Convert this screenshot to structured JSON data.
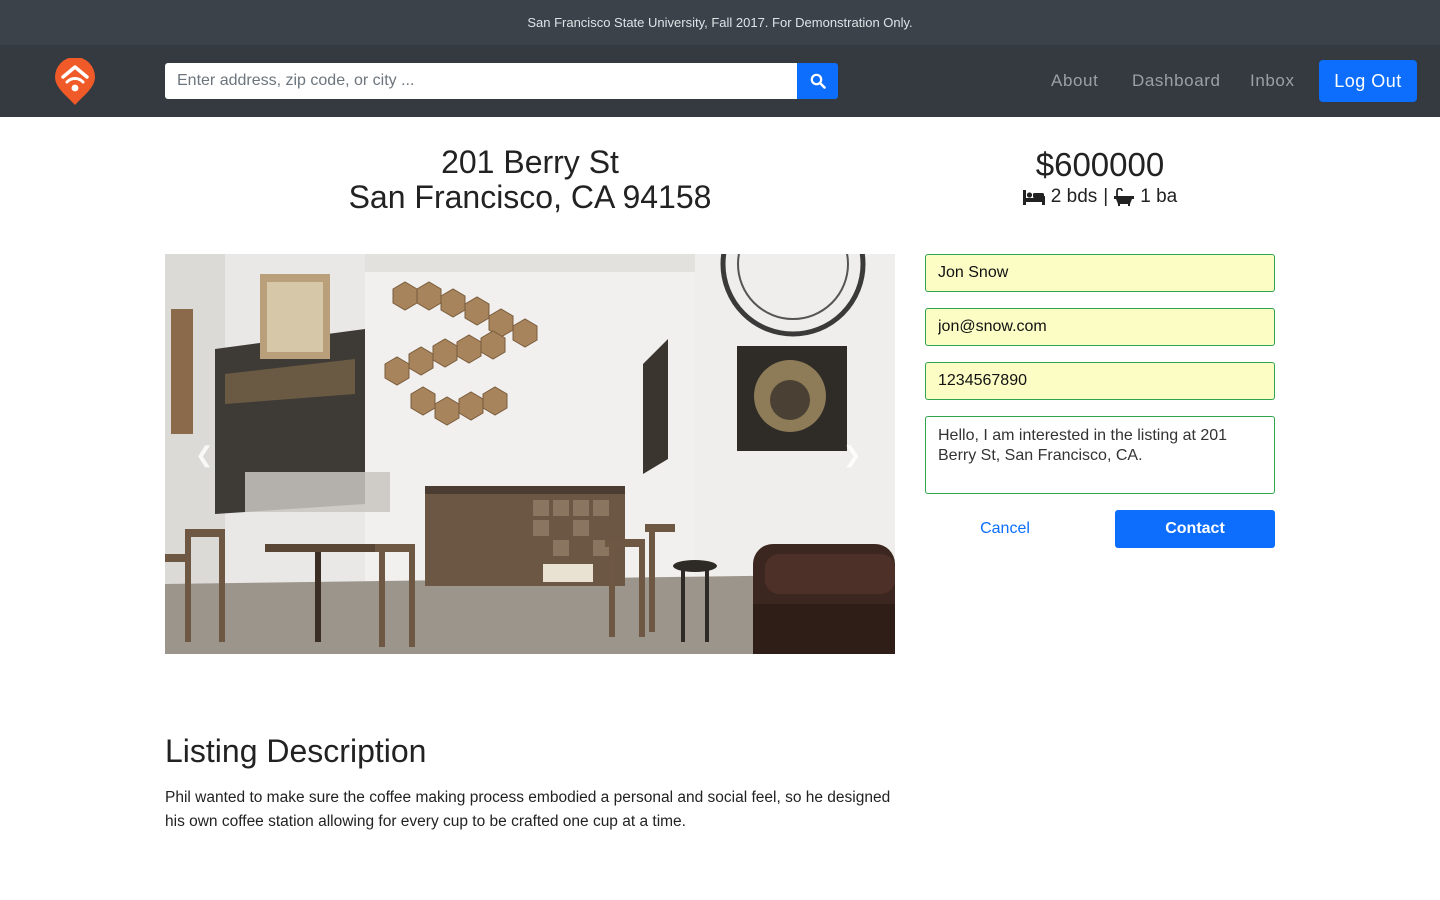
{
  "banner": {
    "text": "San Francisco State University, Fall 2017. For Demonstration Only."
  },
  "header": {
    "logo_icon": "house-pin-logo",
    "search": {
      "placeholder": "Enter address, zip code, or city ...",
      "value": "",
      "button_icon": "search-icon"
    },
    "nav": [
      {
        "label": "About"
      },
      {
        "label": "Dashboard"
      },
      {
        "label": "Inbox"
      }
    ],
    "logout_label": "Log Out",
    "colors": {
      "bar": "#343a40",
      "accent": "#0d6efd",
      "logo": "#f05a28"
    }
  },
  "listing": {
    "address_line1": "201 Berry St",
    "address_line2": "San Francisco, CA 94158",
    "price": "$600000",
    "beds": "2 bds",
    "baths": "1 ba",
    "separator": "|",
    "bed_icon": "bed-icon",
    "bath_icon": "bathtub-icon",
    "photo_icons": {
      "prev": "chevron-left-icon",
      "next": "chevron-right-icon"
    }
  },
  "contact_form": {
    "name": "Jon Snow",
    "email": "jon@snow.com",
    "phone": "1234567890",
    "message": "Hello, I am interested in the listing at 201 Berry St, San Francisco, CA.",
    "cancel_label": "Cancel",
    "contact_label": "Contact"
  },
  "description": {
    "title": "Listing Description",
    "text": "Phil wanted to make sure the coffee making process embodied a personal and social feel, so he designed his own coffee station allowing for every cup to be crafted one cup at a time."
  }
}
